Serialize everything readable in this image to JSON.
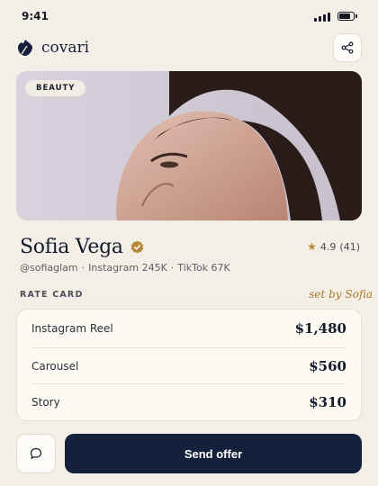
{
  "status_bar": {
    "time": "9:41",
    "icons": [
      "signal-icon",
      "battery-icon"
    ]
  },
  "header": {
    "brand": "covari",
    "logo_icon": "leaf-logo-icon",
    "share_icon": "share-icon"
  },
  "hero": {
    "category": "BEAUTY"
  },
  "creator": {
    "name": "Sofia Vega",
    "verified_icon": "verified-badge-icon",
    "rating": "4.9",
    "reviews": "(41)",
    "handle": "@sofiaglam",
    "platform_1": "Instagram 245K",
    "platform_2": "TikTok 67K"
  },
  "rate_card": {
    "label": "RATE CARD",
    "note": "set by Sofia",
    "items": [
      {
        "name": "Instagram Reel",
        "price": "$1,480"
      },
      {
        "name": "Carousel",
        "price": "$560"
      },
      {
        "name": "Story",
        "price": "$310"
      }
    ]
  },
  "footer": {
    "message_icon": "chat-bubble-icon",
    "offer_label": "Send offer"
  },
  "colors": {
    "background": "#f4efe6",
    "primary": "#14213d",
    "accent": "#b7893a"
  }
}
